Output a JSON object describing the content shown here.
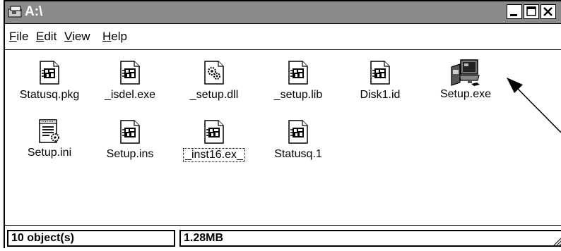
{
  "window": {
    "title": "A:\\",
    "minimize_symbol": "_",
    "maximize_symbol": "□",
    "close_symbol": "×"
  },
  "menu": {
    "items": [
      {
        "accel": "F",
        "rest": "ile"
      },
      {
        "accel": "E",
        "rest": "dit"
      },
      {
        "accel": "V",
        "rest": "iew"
      },
      {
        "accel": "H",
        "rest": "elp"
      }
    ]
  },
  "files": [
    {
      "name": "Statusq.pkg",
      "icon": "package-file-icon"
    },
    {
      "name": "_isdel.exe",
      "icon": "package-file-icon"
    },
    {
      "name": "_setup.dll",
      "icon": "dll-file-icon"
    },
    {
      "name": "_setup.lib",
      "icon": "package-file-icon"
    },
    {
      "name": "Disk1.id",
      "icon": "package-file-icon"
    },
    {
      "name": "Setup.exe",
      "icon": "setup-computer-icon"
    },
    {
      "name": "Setup.ini",
      "icon": "ini-file-icon"
    },
    {
      "name": "Setup.ins",
      "icon": "package-file-icon"
    },
    {
      "name": "_inst16.ex_",
      "icon": "package-file-icon",
      "selected": true
    },
    {
      "name": "Statusq.1",
      "icon": "package-file-icon"
    }
  ],
  "status": {
    "objects": "10 object(s)",
    "size": "1.28MB"
  }
}
